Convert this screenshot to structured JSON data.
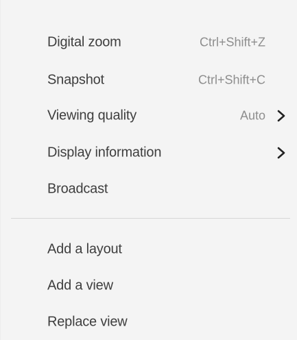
{
  "menu": {
    "items": [
      {
        "label": "Digital zoom",
        "shortcut": "Ctrl+Shift+Z"
      },
      {
        "label": "Snapshot",
        "shortcut": "Ctrl+Shift+C"
      },
      {
        "label": "Viewing quality",
        "value": "Auto",
        "submenu_icon": "chevron-right-icon"
      },
      {
        "label": "Display information",
        "submenu_icon": "chevron-right-icon"
      },
      {
        "label": "Broadcast"
      }
    ],
    "secondary_items": [
      {
        "label": "Add a layout"
      },
      {
        "label": "Add a view"
      },
      {
        "label": "Replace view"
      }
    ]
  }
}
